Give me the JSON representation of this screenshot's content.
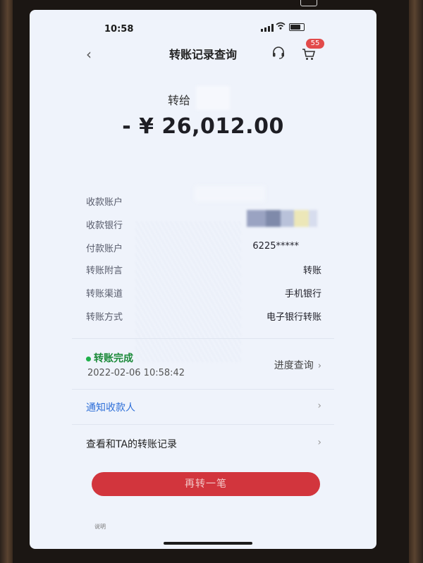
{
  "device_status": {
    "time": "10:58"
  },
  "nav": {
    "title": "转账记录查询",
    "cart_badge": "55"
  },
  "transfer": {
    "payee_prefix": "转给",
    "amount": "- ¥ 26,012.00"
  },
  "details": [
    {
      "label": "收款账户",
      "value": ""
    },
    {
      "label": "收款银行",
      "value": ""
    },
    {
      "label": "付款账户",
      "value": "6225*****"
    },
    {
      "label": "转账附言",
      "value": "转账"
    },
    {
      "label": "转账渠道",
      "value": "手机银行"
    },
    {
      "label": "转账方式",
      "value": "电子银行转账"
    }
  ],
  "status": {
    "label": "转账完成",
    "datetime": "2022-02-06 10:58:42",
    "progress_link": "进度查询"
  },
  "actions": {
    "notify": "通知收款人",
    "history": "查看和TA的转账记录",
    "again_button": "再转一笔"
  },
  "footer": {
    "note": "说明"
  },
  "colors": {
    "accent_red": "#d2353d",
    "success_green": "#1eb04a",
    "link_blue": "#2e6fd8"
  }
}
